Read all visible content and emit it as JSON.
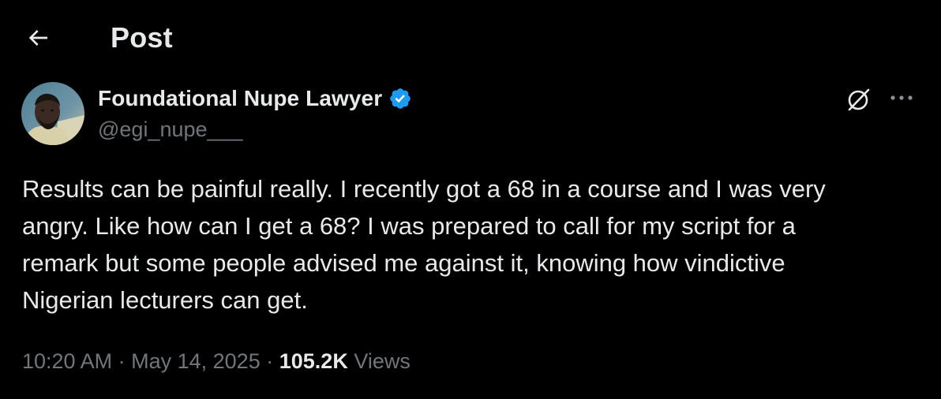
{
  "header": {
    "back_icon": "arrow-left-icon",
    "title": "Post"
  },
  "author": {
    "name": "Foundational Nupe Lawyer",
    "handle": "@egi_nupe___",
    "verified_icon": "verified-badge-icon",
    "verified_color": "#1d9bf0"
  },
  "actions": {
    "grok_icon": "grok-icon",
    "more_icon": "more-dots-icon"
  },
  "tweet": {
    "text": "Results can be painful really. I recently got a 68 in a course and I was very\nangry. Like how can I get a 68? I was prepared to call for my script for a\nremark but some people advised me against it, knowing how vindictive\nNigerian lecturers can get."
  },
  "meta": {
    "time": "10:20 AM",
    "separator": "·",
    "date": "May 14, 2025",
    "views_count": "105.2K",
    "views_label": "Views"
  },
  "colors": {
    "background": "#000000",
    "primary_text": "#e7e9ea",
    "secondary_text": "#71767b",
    "accent": "#1d9bf0"
  }
}
